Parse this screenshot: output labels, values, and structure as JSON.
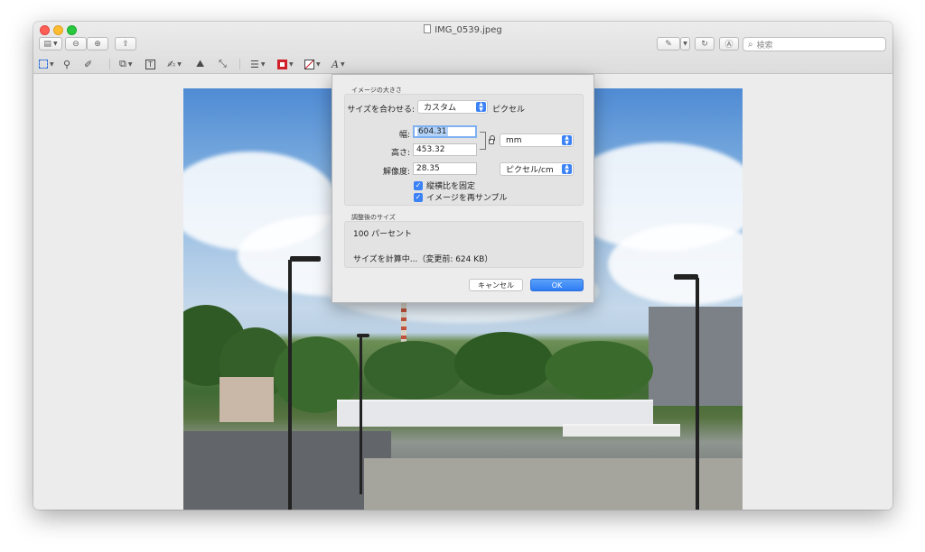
{
  "window": {
    "title": "IMG_0539.jpeg"
  },
  "toolbar": {
    "search_placeholder": "検索"
  },
  "dialog": {
    "image_size_section": "イメージの大きさ",
    "fit_label": "サイズを合わせる:",
    "fit_value": "カスタム",
    "fit_unit": "ピクセル",
    "width_label": "幅:",
    "width_value": "604.31",
    "height_label": "高さ:",
    "height_value": "453.32",
    "size_unit": "mm",
    "resolution_label": "解像度:",
    "resolution_value": "28.35",
    "resolution_unit": "ピクセル/cm",
    "constrain_label": "縦横比を固定",
    "resample_label": "イメージを再サンプル",
    "result_section": "調整後のサイズ",
    "percent_text": "100 パーセント",
    "computing_text": "サイズを計算中...（変更前: 624 KB）",
    "cancel_label": "キャンセル",
    "ok_label": "OK"
  },
  "colors": {
    "accent": "#3b82f6",
    "close": "#fe5f57",
    "minimize": "#febc2e",
    "maximize": "#28c840"
  }
}
